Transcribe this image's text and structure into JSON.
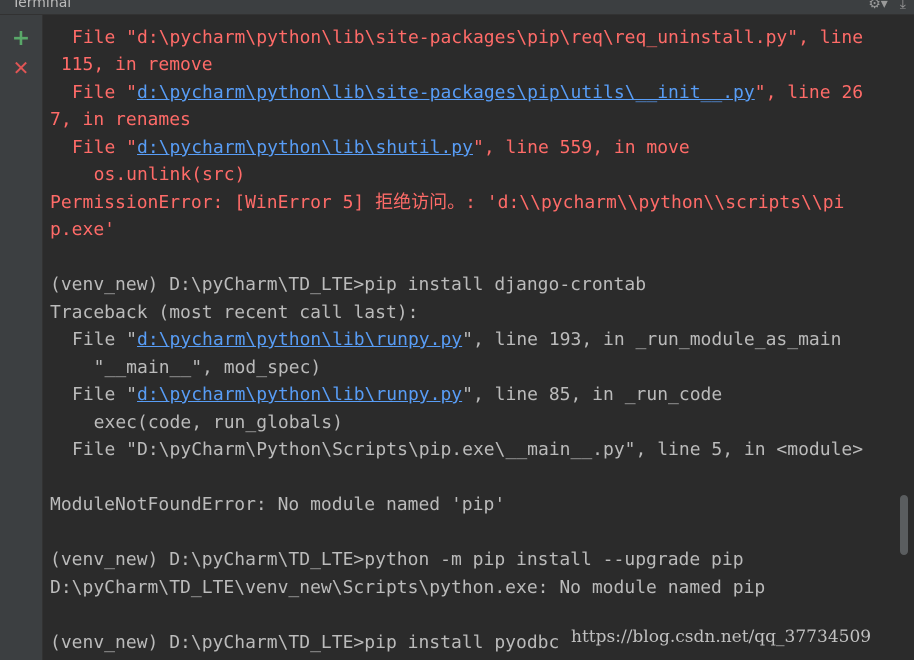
{
  "window": {
    "title": "Terminal"
  },
  "toolbar": {
    "add_icon": "plus-icon",
    "close_icon": "close-icon",
    "settings_icon": "gear-icon",
    "hide_icon": "hide-icon"
  },
  "terminal": {
    "l1a": "File \"d:\\pycharm\\python\\lib\\site-packages\\pip\\req\\req_uninstall.py\", line",
    "l2": " 115, in remove",
    "l3a": "File \"",
    "l3link": "d:\\pycharm\\python\\lib\\site-packages\\pip\\utils\\__init__.py",
    "l3b": "\", line 26",
    "l4": "7, in renames",
    "l5a": "File \"",
    "l5link": "d:\\pycharm\\python\\lib\\shutil.py",
    "l5b": "\", line 559, in move",
    "l6": "  os.unlink(src)",
    "l7": "PermissionError: [WinError 5] 拒绝访问。: 'd:\\\\pycharm\\\\python\\\\scripts\\\\pi",
    "l8": "p.exe'",
    "l10": "(venv_new) D:\\pyCharm\\TD_LTE>pip install django-crontab",
    "l11": "Traceback (most recent call last):",
    "l12a": "File \"",
    "l12link": "d:\\pycharm\\python\\lib\\runpy.py",
    "l12b": "\", line 193, in _run_module_as_main",
    "l13": "  \"__main__\", mod_spec)",
    "l14a": "File \"",
    "l14link": "d:\\pycharm\\python\\lib\\runpy.py",
    "l14b": "\", line 85, in _run_code",
    "l15": "  exec(code, run_globals)",
    "l16": "File \"D:\\pyCharm\\Python\\Scripts\\pip.exe\\__main__.py\", line 5, in <module>",
    "l18": "ModuleNotFoundError: No module named 'pip'",
    "l20": "(venv_new) D:\\pyCharm\\TD_LTE>python -m pip install --upgrade pip",
    "l21": "D:\\pyCharm\\TD_LTE\\venv_new\\Scripts\\python.exe: No module named pip",
    "l23": "(venv_new) D:\\pyCharm\\TD_LTE>pip install pyodbc"
  },
  "watermark": "https://blog.csdn.net/qq_37734509"
}
